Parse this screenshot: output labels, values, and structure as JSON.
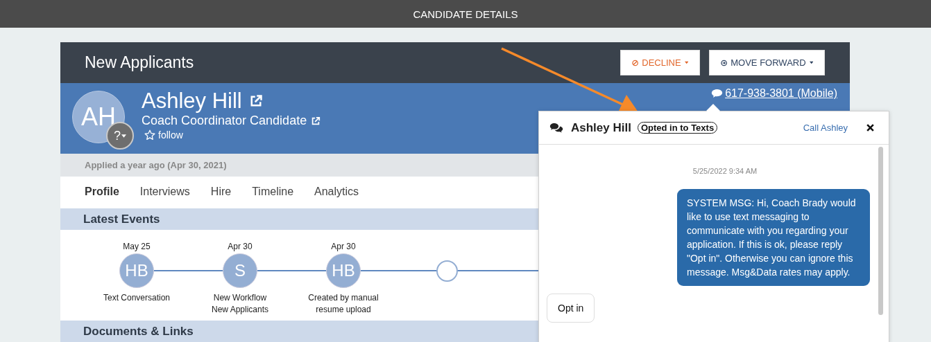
{
  "top_bar": {
    "title": "CANDIDATE DETAILS"
  },
  "header": {
    "title": "New Applicants",
    "buttons": [
      {
        "label": "DECLINE",
        "kind": "danger"
      },
      {
        "label": "MOVE FORWARD",
        "kind": "default"
      }
    ]
  },
  "candidate": {
    "initials": "AH",
    "status_badge": "?",
    "name": "Ashley Hill",
    "role": "Coach Coordinator Candidate",
    "follow": "follow",
    "phone": "617-938-3801 (Mobile)",
    "applied": "Applied a year ago (Apr 30, 2021)"
  },
  "tabs": [
    {
      "label": "Profile",
      "selected": true
    },
    {
      "label": "Interviews",
      "selected": false
    },
    {
      "label": "Hire",
      "selected": false
    },
    {
      "label": "Timeline",
      "selected": false
    },
    {
      "label": "Analytics",
      "selected": false
    }
  ],
  "latest_events": {
    "title": "Latest Events",
    "events": [
      {
        "kind": "event",
        "date": "May 25",
        "initials": "HB",
        "caption": "Text Conversation"
      },
      {
        "kind": "event",
        "date": "Apr 30",
        "initials": "S",
        "caption": "New Workflow\nNew Applicants"
      },
      {
        "kind": "event",
        "date": "Apr 30",
        "initials": "HB",
        "caption": "Created by manual\nresume upload"
      },
      {
        "kind": "empty"
      }
    ]
  },
  "documents": {
    "title": "Documents & Links"
  },
  "chat": {
    "name": "Ashley Hill",
    "badge": "Opted in to Texts",
    "call_link": "Call Ashley",
    "messages": [
      {
        "kind": "timestamp",
        "text": "5/25/2022 9:34 AM"
      },
      {
        "kind": "outgoing",
        "text": "SYSTEM MSG: Hi, Coach Brady would like to use text messaging to communicate with you regarding your application. If this is ok, please reply \"Opt in\". Otherwise you can ignore this message. Msg&Data rates may apply."
      },
      {
        "kind": "incoming",
        "text": "Opt in"
      }
    ]
  }
}
